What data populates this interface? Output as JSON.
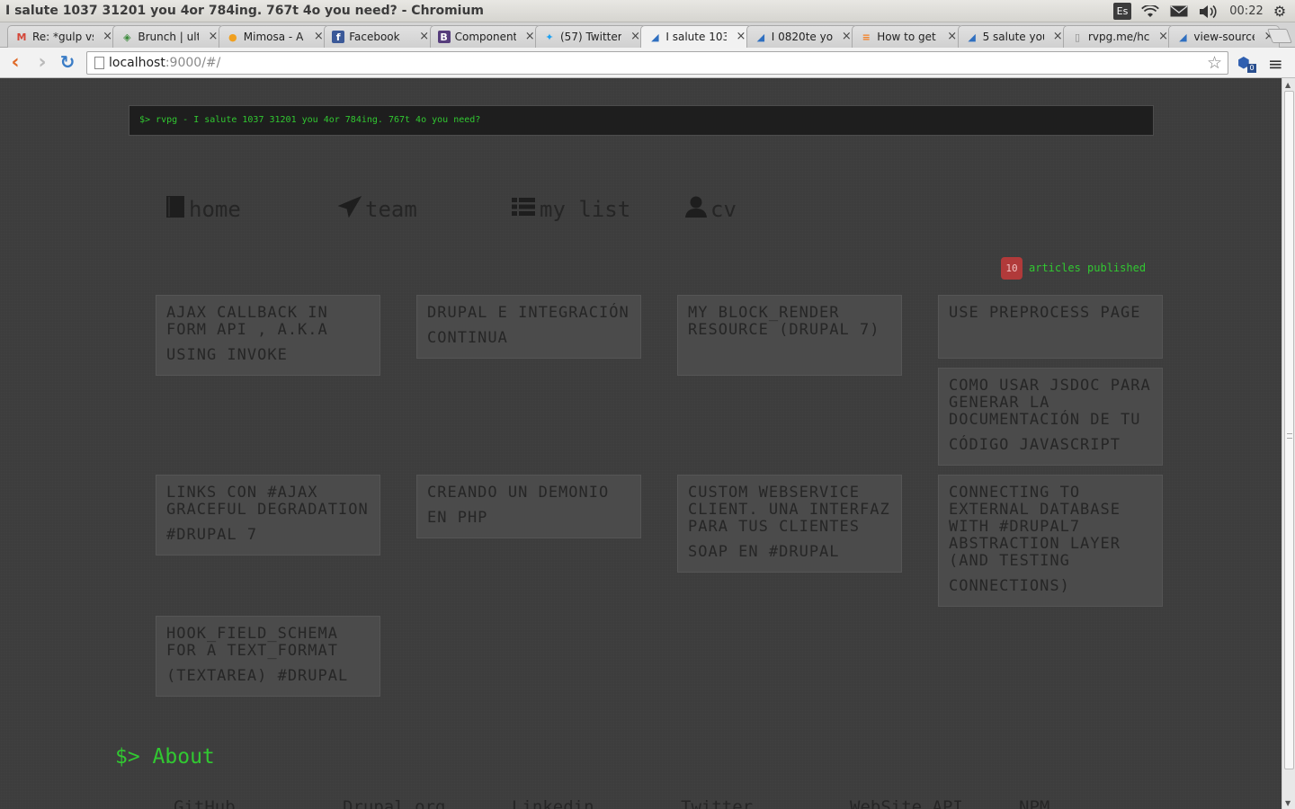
{
  "os": {
    "window_title": "I salute 1037 31201 you 4or 784ing. 767t 4o you need? - Chromium",
    "lang": "Es",
    "time": "00:22"
  },
  "tabs": [
    {
      "label": "Re: *gulp vs",
      "favicon": "gmail-icon",
      "fav_text": "M",
      "fav_color": "#d44638",
      "fav_bg": "transparent",
      "active": false
    },
    {
      "label": "Brunch | ult",
      "favicon": "brunch-icon",
      "fav_text": "◈",
      "fav_color": "#3a8a3a",
      "fav_bg": "transparent",
      "active": false
    },
    {
      "label": "Mimosa - A",
      "favicon": "mimosa-icon",
      "fav_text": "●",
      "fav_color": "#f0a020",
      "fav_bg": "transparent",
      "active": false
    },
    {
      "label": "Facebook",
      "favicon": "facebook-icon",
      "fav_text": "f",
      "fav_color": "#ffffff",
      "fav_bg": "#3b5998",
      "active": false
    },
    {
      "label": "Component",
      "favicon": "bootstrap-icon",
      "fav_text": "B",
      "fav_color": "#ffffff",
      "fav_bg": "#563d7c",
      "active": false
    },
    {
      "label": "(57) Twitter",
      "favicon": "twitter-icon",
      "fav_text": "✦",
      "fav_color": "#1da1f2",
      "fav_bg": "transparent",
      "active": false
    },
    {
      "label": "I salute 103",
      "favicon": "page-icon",
      "fav_text": "◢",
      "fav_color": "#2f6fc0",
      "fav_bg": "transparent",
      "active": true
    },
    {
      "label": "I 0820te yo",
      "favicon": "page-icon",
      "fav_text": "◢",
      "fav_color": "#2f6fc0",
      "fav_bg": "transparent",
      "active": false
    },
    {
      "label": "How to get",
      "favicon": "stackoverflow-icon",
      "fav_text": "≡",
      "fav_color": "#f48024",
      "fav_bg": "transparent",
      "active": false
    },
    {
      "label": "5 salute you",
      "favicon": "page-icon",
      "fav_text": "◢",
      "fav_color": "#2f6fc0",
      "fav_bg": "transparent",
      "active": false
    },
    {
      "label": "rvpg.me/hc",
      "favicon": "document-icon",
      "fav_text": "▯",
      "fav_color": "#888888",
      "fav_bg": "transparent",
      "active": false
    },
    {
      "label": "view-source",
      "favicon": "page-icon",
      "fav_text": "◢",
      "fav_color": "#2f6fc0",
      "fav_bg": "transparent",
      "active": false
    }
  ],
  "toolbar": {
    "url_host": "localhost",
    "url_rest": ":9000/#/",
    "ext_badge": "0"
  },
  "terminal": "$> rvpg - I salute 1037 31201 you 4or 784ing. 767t 4o you need?",
  "nav": {
    "home": "home",
    "team": "team",
    "list": "my list",
    "cv": "cv"
  },
  "articles_count": "10",
  "articles_label": "articles published",
  "cards": [
    {
      "line1": "AJAX CALLBACK IN FORM API , A.K.A",
      "line2": "USING INVOKE"
    },
    {
      "line1": "DRUPAL E INTEGRACIÓN",
      "line2": "CONTINUA"
    },
    {
      "line1": "MY BLOCK_RENDER RESOURCE (DRUPAL 7)",
      "line2": ""
    },
    {
      "line1": "USE PREPROCESS PAGE",
      "line2": ""
    },
    {
      "line1": "COMO USAR JSDOC PARA GENERAR LA DOCUMENTACIÓN DE TU",
      "line2": "CÓDIGO JAVASCRIPT"
    },
    {
      "line1": "LINKS CON #AJAX GRACEFUL DEGRADATION",
      "line2": "#DRUPAL 7"
    },
    {
      "line1": "CREANDO UN DEMONIO",
      "line2": "EN PHP"
    },
    {
      "line1": "CUSTOM WEBSERVICE CLIENT. UNA INTERFAZ PARA TUS CLIENTES",
      "line2": "SOAP EN #DRUPAL"
    },
    {
      "line1": "CONNECTING TO EXTERNAL DATABASE WITH #DRUPAL7 ABSTRACTION LAYER (AND TESTING",
      "line2": "CONNECTIONS)"
    },
    {
      "line1": "HOOK_FIELD_SCHEMA FOR A TEXT_FORMAT",
      "line2": "(TEXTAREA) #DRUPAL"
    }
  ],
  "about": "$> About",
  "footer_links": [
    "GitHub",
    "Drupal.org",
    "Linkedin",
    "Twitter",
    "WebSite API",
    "NPM"
  ]
}
